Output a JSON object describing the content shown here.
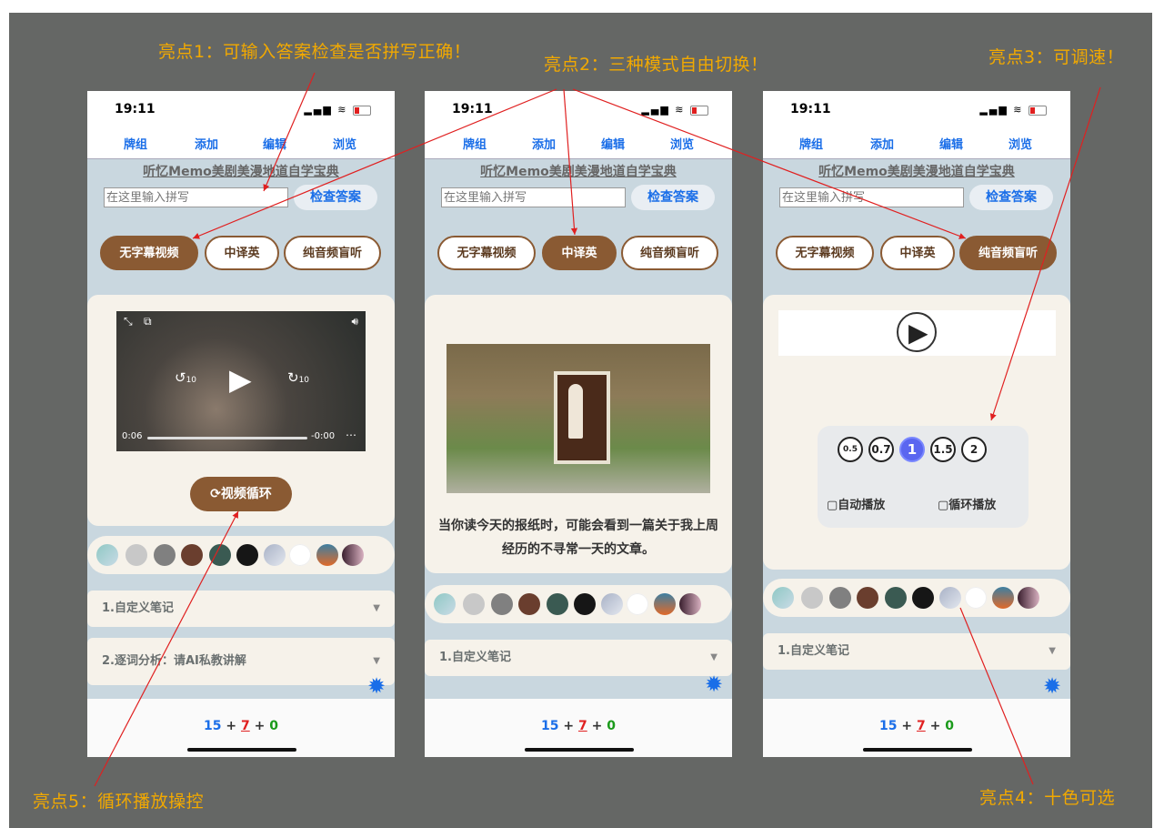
{
  "annotations": {
    "a1": "亮点1：可输入答案检查是否拼写正确！",
    "a2": "亮点2：三种模式自由切换！",
    "a3": "亮点3：可调速！",
    "a4": "亮点4：十色可选",
    "a5": "亮点5：循环播放操控"
  },
  "common": {
    "time": "19:11",
    "nav": [
      "牌组",
      "添加",
      "编辑",
      "浏览"
    ],
    "deck_title": "听忆Memo美剧美漫地道自学宝典",
    "spell_placeholder": "在这里输入拼写",
    "check_button": "检查答案",
    "modes": [
      "无字幕视频",
      "中译英",
      "纯音频盲听"
    ],
    "score": {
      "a": "15",
      "plus": "+",
      "b": "7",
      "c": "0"
    },
    "note1": "1.自定义笔记",
    "note2": "2.逐词分析：请AI私教讲解"
  },
  "phone1": {
    "active_mode": 0,
    "video_elapsed": "0:06",
    "video_remaining": "-0:00",
    "skip_back": "10",
    "skip_forward": "10",
    "loop_button": "视频循环"
  },
  "phone2": {
    "active_mode": 1,
    "translation": "当你读今天的报纸时，可能会看到一篇关于我上周经历的不寻常一天的文章。"
  },
  "phone3": {
    "active_mode": 2,
    "speeds": [
      "0.5",
      "0.7",
      "1",
      "1.5",
      "2"
    ],
    "selected_speed": "1",
    "autoplay": "▢自动播放",
    "loop_play": "▢循环播放"
  },
  "swatch_colors": [
    "linear-gradient(135deg,#8fc8c4,#c9dbe6)",
    "#c8c8c8",
    "#808080",
    "#6a3e2e",
    "#3a5a52",
    "#161616",
    "linear-gradient(135deg,#a9b2c6,#e3e7ef)",
    "#ffffff",
    "linear-gradient(180deg,#3d7fa2,#e06a2a)",
    "linear-gradient(90deg,#3a1f2e,#d8b0c0)"
  ],
  "colors": {
    "accent_brown": "#8a5a33",
    "link_blue": "#1a6ee8",
    "annotation": "#f2a900",
    "arrow": "#e02020"
  }
}
